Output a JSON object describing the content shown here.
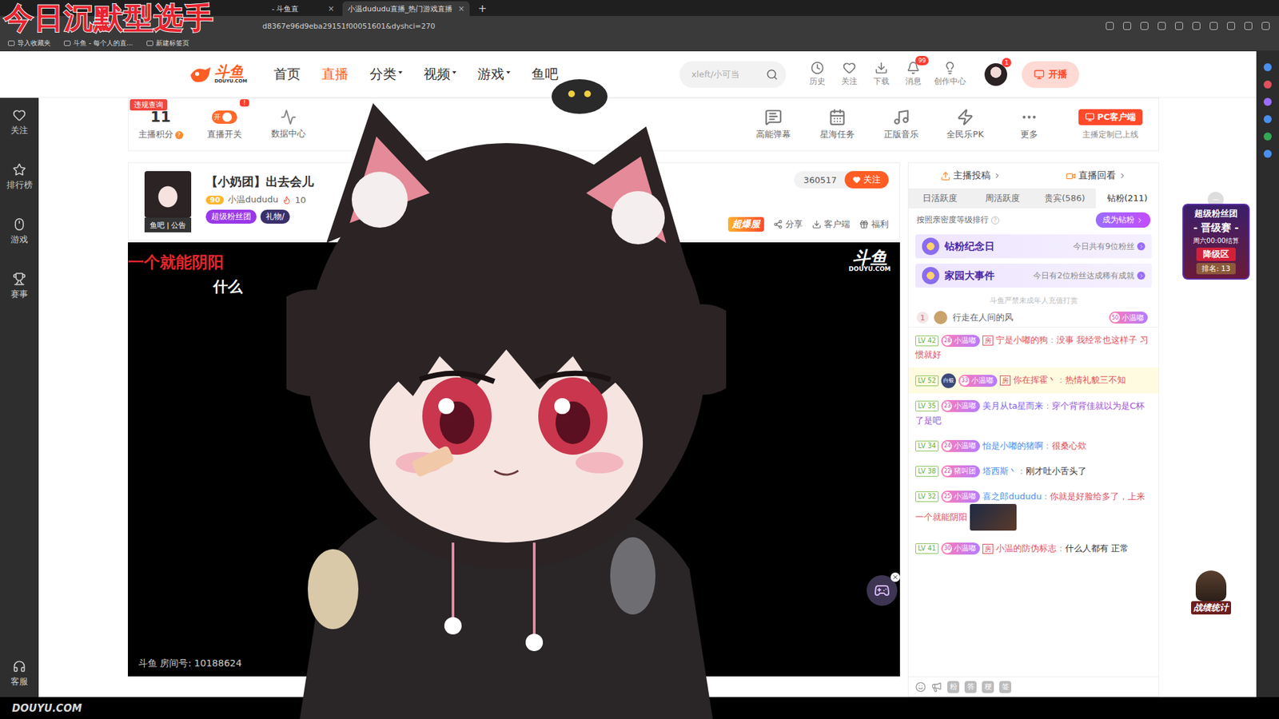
{
  "overlay_title": "今日沉默型选手",
  "browser": {
    "tabs": [
      {
        "label": "- 斗鱼直",
        "selected": false
      },
      {
        "label": "小温dududu直播_热门游戏直播",
        "selected": true
      }
    ],
    "tab_close": "×",
    "new_tab": "+",
    "url": "d8367e96d9eba29151f00051601&dyshci=270",
    "bookmarks": [
      "导入收藏夹",
      "斗鱼 - 每个人的直...",
      "新建标签页"
    ]
  },
  "header": {
    "logo": "斗鱼",
    "logo_sub": "DOUYU.COM",
    "nav": [
      {
        "label": "首页",
        "selected": false,
        "dropdown": false
      },
      {
        "label": "直播",
        "selected": true,
        "dropdown": false
      },
      {
        "label": "分类",
        "selected": false,
        "dropdown": true
      },
      {
        "label": "视频",
        "selected": false,
        "dropdown": true
      },
      {
        "label": "游戏",
        "selected": false,
        "dropdown": true
      },
      {
        "label": "鱼吧",
        "selected": false,
        "dropdown": false
      }
    ],
    "search_placeholder": "xleft/小可当",
    "icons": [
      {
        "label": "历史",
        "badge": ""
      },
      {
        "label": "关注",
        "badge": ""
      },
      {
        "label": "下载",
        "badge": ""
      },
      {
        "label": "消息",
        "badge": "99"
      },
      {
        "label": "创作中心",
        "badge": ""
      }
    ],
    "avatar_badge": "1",
    "live_button": "开播"
  },
  "left_nav": [
    "关注",
    "排行榜",
    "游戏",
    "赛事"
  ],
  "left_nav_bottom": "客服",
  "toolbar": {
    "violation_badge": "违规查询",
    "score": "11",
    "score_label": "主播积分",
    "toggle_text": "开",
    "toggle_on": true,
    "toggle_badge": "!",
    "toggle_label": "直播开关",
    "data_center": "数据中心",
    "tools": [
      "高能弹幕",
      "星海任务",
      "正版音乐",
      "全民乐PK",
      "更多"
    ],
    "client_button": "PC客户端",
    "client_note": "主播定制已上线"
  },
  "room": {
    "title": "【小奶团】出去会儿",
    "level": "90",
    "streamer": "小温dududu",
    "heat": "10",
    "avatar_strip": "鱼吧 | 公告",
    "tags": [
      "超级粉丝团",
      "礼物/"
    ],
    "followers": "360517",
    "follow_button": "关注",
    "event_badge": "超爆服",
    "actions": [
      "分享",
      "客户端",
      "福利"
    ]
  },
  "video": {
    "danmaku": [
      {
        "text": "一个就能阴阳",
        "color": "#e8262b"
      },
      {
        "text": "什么",
        "color": "#ffffff"
      }
    ],
    "watermark": "斗鱼",
    "watermark_sub": "DOUYU.COM",
    "room_id": "斗鱼 房间号: 10188624"
  },
  "chat": {
    "top_tabs": [
      "主播投稿",
      "直播回看"
    ],
    "tabs": [
      {
        "label": "日活跃度",
        "selected": false
      },
      {
        "label": "周活跃度",
        "selected": false
      },
      {
        "label": "贵宾(586)",
        "selected": false
      },
      {
        "label": "钻粉(211)",
        "selected": true
      }
    ],
    "rank_hint": "按照亲密度等级排行",
    "rank_hint_icon": "?",
    "become_button": "成为钻粉",
    "cards": [
      {
        "title": "钻粉纪念日",
        "note": "今日共有9位粉丝"
      },
      {
        "title": "家园大事件",
        "note": "今日有2位粉丝达成稀有成就"
      }
    ],
    "notice": "斗鱼严禁未成年人充值打赏",
    "rank_row": {
      "rank": "1",
      "name": "行走在人间的风",
      "badge": "小温嘟",
      "badge_level": "50"
    },
    "messages": [
      {
        "level": "LV 42",
        "medal": "",
        "badge": "小温嘟",
        "badge_level": "28",
        "room_badge": "房",
        "name": "宁是小嘟的狗",
        "name_color": "#e0505e",
        "text": "没事 我经常也这样子 习惯就好",
        "color": "#e0505e",
        "highlighted": false,
        "sticker": false
      },
      {
        "level": "LV 52",
        "medal": "白银",
        "badge": "小温嘟",
        "badge_level": "33",
        "room_badge": "房",
        "name": "你在挥霍丶",
        "name_color": "#e0505e",
        "text": "热情礼貌三不知",
        "color": "#e0505e",
        "highlighted": true,
        "sticker": false
      },
      {
        "level": "LV 35",
        "medal": "",
        "badge": "小温嘟",
        "badge_level": "23",
        "room_badge": "",
        "name": "美月从ta星而来",
        "name_color": "#7a5cf0",
        "text": "穿个背背佳就以为是C杯了是吧",
        "color": "#9b4fd8",
        "highlighted": false,
        "sticker": false
      },
      {
        "level": "LV 34",
        "medal": "",
        "badge": "小温嘟",
        "badge_level": "24",
        "room_badge": "",
        "name": "怡是小嘟的猪啊",
        "name_color": "#4a8ff0",
        "text": "很桑心欸",
        "color": "#e0505e",
        "highlighted": false,
        "sticker": false
      },
      {
        "level": "LV 38",
        "medal": "",
        "badge": "猪叫团",
        "badge_level": "22",
        "room_badge": "",
        "name": "塔西斯丶",
        "name_color": "#4a8ff0",
        "text": "刚才吐小舌头了",
        "color": "#333333",
        "highlighted": false,
        "sticker": false
      },
      {
        "level": "LV 32",
        "medal": "",
        "badge": "小温嘟",
        "badge_level": "25",
        "room_badge": "",
        "name": "喜之郎dududu",
        "name_color": "#4a8ff0",
        "text": "你就是好脸给多了，上来一个就能阴阳",
        "color": "#e0505e",
        "highlighted": false,
        "sticker": true
      },
      {
        "level": "LV 41",
        "medal": "",
        "badge": "小温嘟",
        "badge_level": "30",
        "room_badge": "房",
        "name": "小温的防伪标志",
        "name_color": "#e0505e",
        "text": "什么人都有 正常",
        "color": "#333333",
        "highlighted": false,
        "sticker": false
      }
    ],
    "tool_glyphs": [
      "粉",
      "答",
      "梗",
      "签"
    ]
  },
  "fan_club": {
    "title": "超级粉丝团",
    "stage": "- 晋级赛 -",
    "settle": "周六00:00结算",
    "zone": "降级区",
    "rank": "排名: 13"
  },
  "battle_stats": "战绩统计",
  "footer_watermark": "DOUYU.COM"
}
